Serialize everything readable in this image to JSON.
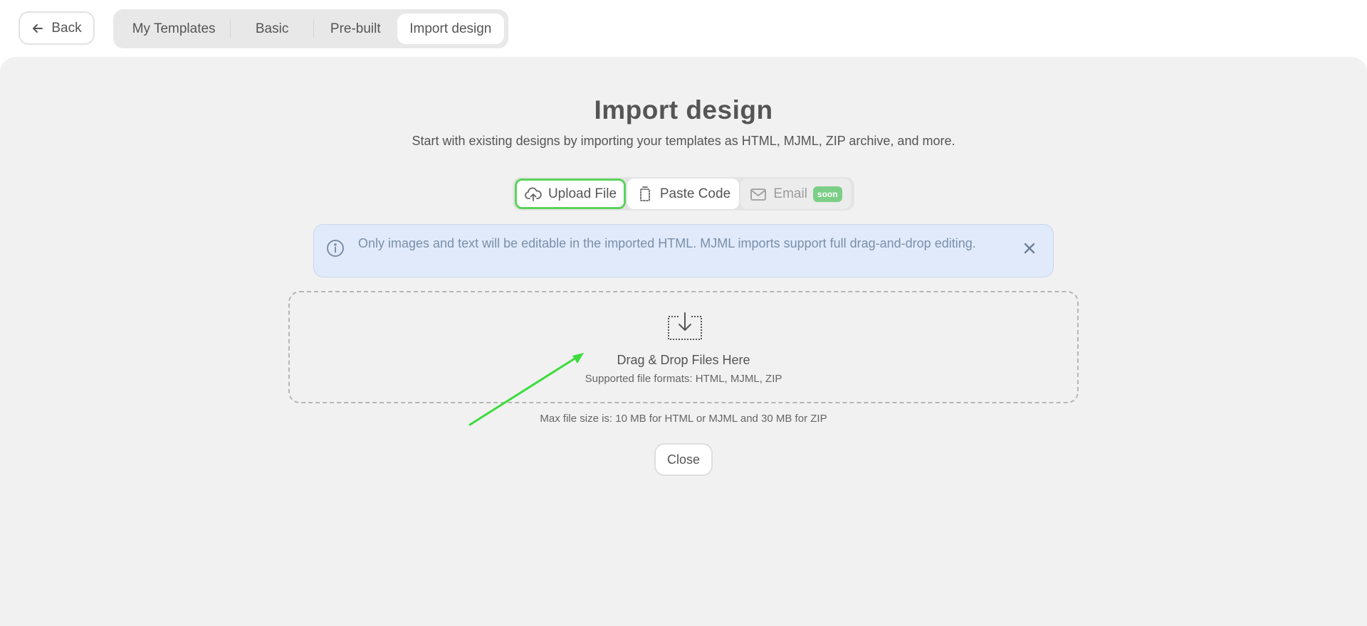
{
  "header": {
    "back_label": "Back",
    "tabs": [
      {
        "label": "My Templates"
      },
      {
        "label": "Basic"
      },
      {
        "label": "Pre-built"
      },
      {
        "label": "Import design",
        "active": true
      }
    ]
  },
  "main": {
    "title": "Import design",
    "subtitle": "Start with existing designs by importing your templates as HTML, MJML, ZIP archive, and more.",
    "modes": [
      {
        "label": "Upload File",
        "icon": "cloud-upload-icon",
        "selected": true
      },
      {
        "label": "Paste Code",
        "icon": "paste-icon"
      },
      {
        "label": "Email",
        "icon": "mail-icon",
        "badge": "soon",
        "disabled": true
      }
    ],
    "alert": {
      "message": "Only images and text will be editable in the imported HTML. MJML imports support full drag-and-drop editing."
    },
    "dropzone": {
      "title": "Drag & Drop Files Here",
      "formats": "Supported file formats: HTML, MJML, ZIP"
    },
    "max_size": "Max file size is: 10 MB for HTML or MJML and 30 MB for ZIP",
    "close_label": "Close"
  },
  "colors": {
    "accent_green": "#5bd35b",
    "badge_green": "#7ccf86",
    "alert_bg": "#e0eafb",
    "panel_bg": "#f1f1f1"
  }
}
